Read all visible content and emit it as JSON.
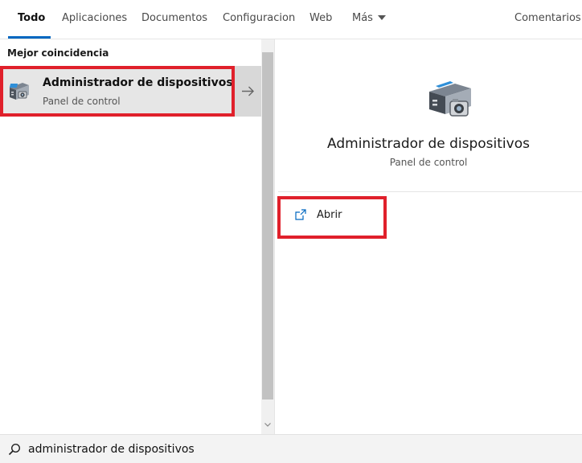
{
  "tabs": {
    "items": [
      {
        "label": "Todo",
        "active": true
      },
      {
        "label": "Aplicaciones"
      },
      {
        "label": "Documentos"
      },
      {
        "label": "Configuracion"
      },
      {
        "label": "Web"
      },
      {
        "label": "Más",
        "icon": "chevron-down-icon"
      }
    ],
    "feedback_label": "Comentarios"
  },
  "results": {
    "section_title": "Mejor coincidencia",
    "best_match": {
      "title": "Administrador de dispositivos",
      "subtitle": "Panel de control",
      "icon": "device-manager-icon"
    }
  },
  "detail": {
    "title": "Administrador de dispositivos",
    "subtitle": "Panel de control",
    "icon": "device-manager-icon",
    "actions": [
      {
        "label": "Abrir",
        "icon": "open-icon"
      }
    ]
  },
  "search": {
    "value": "administrador de dispositivos",
    "icon": "search-icon"
  },
  "colors": {
    "accent": "#0067c0",
    "highlight_box": "#e0202b",
    "selected_bg": "#e6e6e6"
  }
}
